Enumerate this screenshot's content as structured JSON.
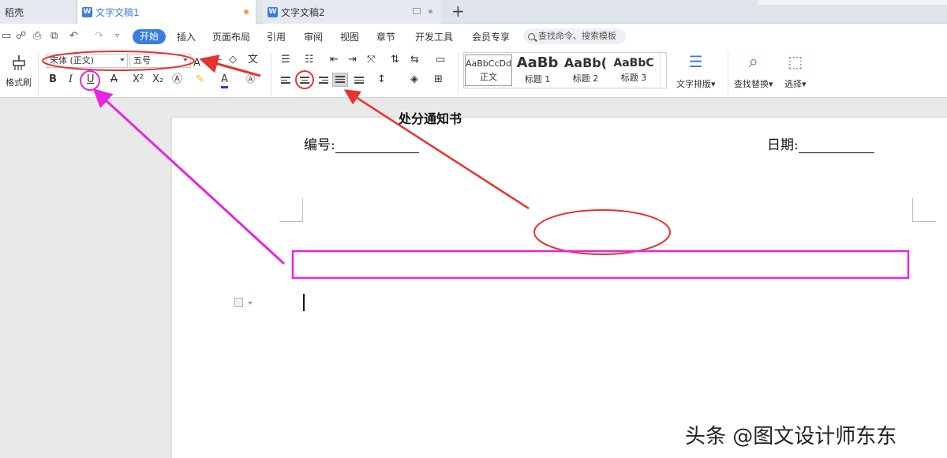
{
  "tabs": {
    "home": "稻壳",
    "doc1": "文字文稿1",
    "doc2": "文字文稿2",
    "doc_icon": "W"
  },
  "menu": {
    "items": [
      "开始",
      "插入",
      "页面布局",
      "引用",
      "审阅",
      "视图",
      "章节",
      "开发工具",
      "会员专享"
    ],
    "search_placeholder": "查找命令、搜索模板"
  },
  "ribbon": {
    "format_painter": "格式刷",
    "font_name": "宋体 (正文)",
    "font_size": "五号",
    "bold": "B",
    "italic": "I",
    "underline": "U",
    "strike": "A",
    "superscript": "X²",
    "subscript": "X₂",
    "font_color": "A",
    "phonetic": "文",
    "styles": [
      {
        "sample": "AaBbCcDd",
        "caption": "正文"
      },
      {
        "sample": "AaBb",
        "caption": "标题 1"
      },
      {
        "sample": "AaBb(",
        "caption": "标题 2"
      },
      {
        "sample": "AaBbC",
        "caption": "标题 3"
      }
    ],
    "text_layout": "文字排版",
    "find_replace": "查找替换",
    "select": "选择"
  },
  "document": {
    "title": "处分通知书",
    "number_label": "编号:",
    "date_label": "日期:"
  },
  "watermark": "头条 @图文设计师东东",
  "colors": {
    "accent": "#3a7de0",
    "annotation_red": "#e8322f",
    "annotation_magenta": "#e426e0"
  }
}
